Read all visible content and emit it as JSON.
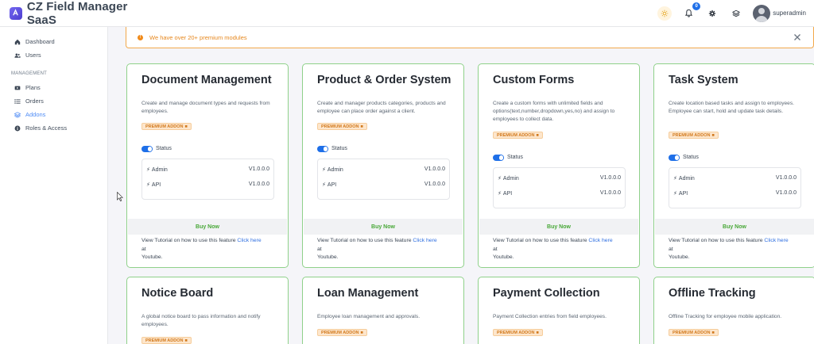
{
  "brand": {
    "title": "CZ Field Manager SaaS"
  },
  "header": {
    "notification_count": "0",
    "username": "superadmin"
  },
  "sidebar": {
    "items": [
      {
        "label": "Dashboard",
        "icon": "home-icon"
      },
      {
        "label": "Users",
        "icon": "users-icon"
      }
    ],
    "section_label": "MANAGEMENT",
    "management_items": [
      {
        "label": "Plans",
        "icon": "plans-icon"
      },
      {
        "label": "Orders",
        "icon": "list-icon"
      },
      {
        "label": "Addons",
        "icon": "layers-icon",
        "active": true
      },
      {
        "label": "Roles & Access",
        "icon": "info-icon"
      }
    ]
  },
  "alert": {
    "text": "We have over 20+ premium modules"
  },
  "common": {
    "premium_label": "PREMIUM ADDON",
    "status_label": "Status",
    "admin_label": "Admin",
    "api_label": "API",
    "buy_label": "Buy Now",
    "tutorial_prefix": "View Tutorial on how to use this feature",
    "tutorial_link": "Click here",
    "tutorial_at": "at",
    "tutorial_youtube": "Youtube."
  },
  "cards": [
    {
      "title": "Document Management",
      "description": "Create and manage document types and requests from employees.",
      "admin_version": "V1.0.0.0",
      "api_version": "V1.0.0.0"
    },
    {
      "title": "Product & Order System",
      "description": "Create and manager products categories, products and employee can place order against a client.",
      "admin_version": "V1.0.0.0",
      "api_version": "V1.0.0.0"
    },
    {
      "title": "Custom Forms",
      "description": "Create a custom forms with unlimited fields and options(text,number,dropdown,yes,no) and assign to employees to collect data.",
      "admin_version": "V1.0.0.0",
      "api_version": "V1.0.0.0"
    },
    {
      "title": "Task System",
      "description": "Create location based tasks and assign to employees. Employee can start, hold and update task details.",
      "admin_version": "V1.0.0.0",
      "api_version": "V1.0.0.0"
    },
    {
      "title": "Notice Board",
      "description": "A global notice board to pass information and notify employees."
    },
    {
      "title": "Loan Management",
      "description": "Employee loan management and approvals."
    },
    {
      "title": "Payment Collection",
      "description": "Payment Collection entries from field employees."
    },
    {
      "title": "Offline Tracking",
      "description": "Offline Tracking for employee mobile application."
    }
  ],
  "colors": {
    "accent": "#1e6fe8",
    "success": "#48a837",
    "warning": "#f08a1a",
    "card_border": "#8fd18a"
  }
}
